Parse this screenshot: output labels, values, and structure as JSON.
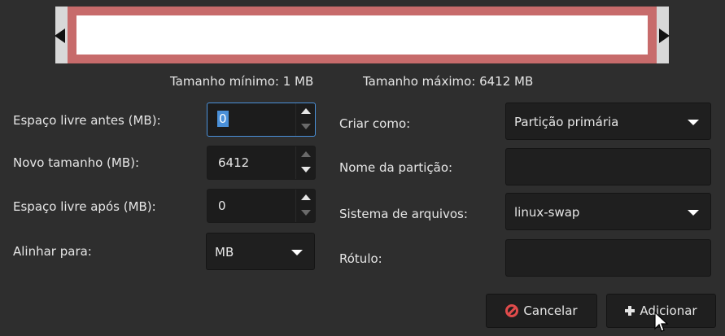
{
  "resizer": {
    "min_size_text": "Tamanho mínimo: 1 MB",
    "max_size_text": "Tamanho máximo: 6412 MB",
    "partition_fill_color": "#c76b6b"
  },
  "left": {
    "free_before_label": "Espaço livre antes (MB):",
    "free_before_value": "0",
    "new_size_label": "Novo tamanho (MB):",
    "new_size_value": "6412",
    "free_after_label": "Espaço livre após (MB):",
    "free_after_value": "0",
    "align_label": "Alinhar para:",
    "align_value": "MB"
  },
  "right": {
    "create_as_label": "Criar como:",
    "create_as_value": "Partição primária",
    "partition_name_label": "Nome da partição:",
    "partition_name_value": "",
    "filesystem_label": "Sistema de arquivos:",
    "filesystem_value": "linux-swap",
    "label_label": "Rótulo:",
    "label_value": ""
  },
  "buttons": {
    "cancel_label": "Cancelar",
    "add_label": "Adicionar"
  },
  "icons": {
    "cancel": "cancel-icon",
    "add": "plus-icon"
  }
}
